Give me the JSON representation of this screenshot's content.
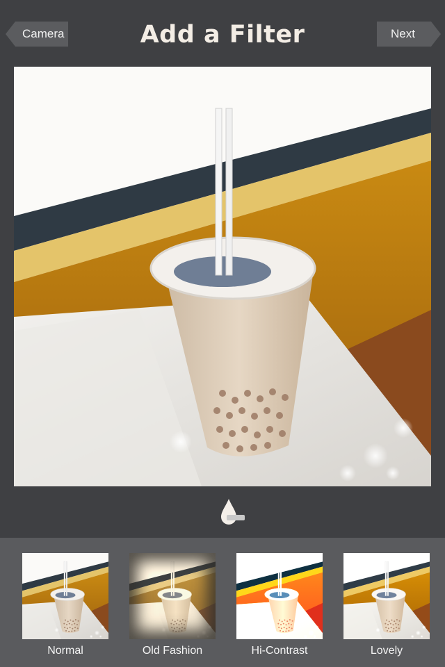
{
  "header": {
    "title": "Add a Filter",
    "back_label": "Camera",
    "next_label": "Next"
  },
  "toolbar": {
    "tool_icon": "water-drop-icon"
  },
  "filters": [
    {
      "label": "Normal"
    },
    {
      "label": "Old Fashion"
    },
    {
      "label": "Hi-Contrast"
    },
    {
      "label": "Lovely"
    }
  ],
  "colors": {
    "background": "#3f4043",
    "tray": "#5a5b5e",
    "button": "#5b5c5f",
    "title": "#f3ede5"
  }
}
